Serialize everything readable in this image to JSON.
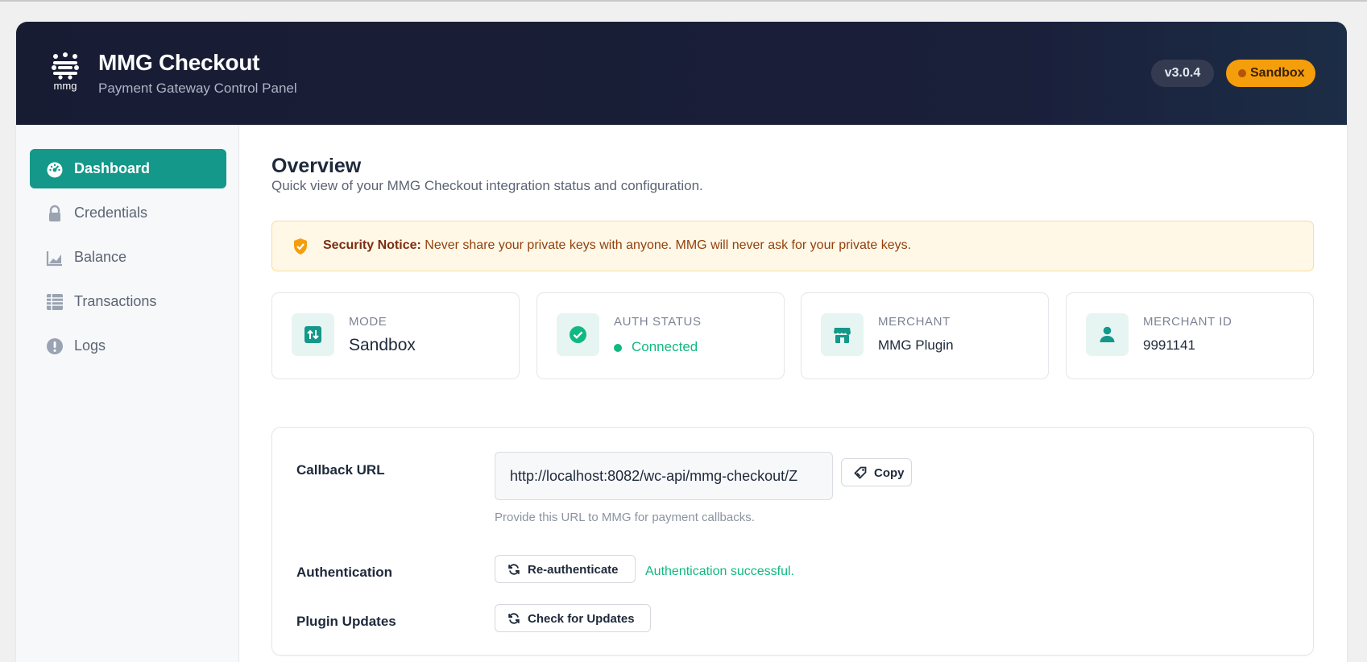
{
  "app": {
    "title": "MMG Checkout",
    "subtitle": "Payment Gateway Control Panel",
    "logo_text": "mmg",
    "version": "v3.0.4",
    "environment": "Sandbox"
  },
  "colors": {
    "header_bg": "#1a1f3a",
    "accent": "#14988a",
    "sandbox_badge": "#f59e0b",
    "success": "#10b981",
    "notice_bg": "#fff8e6"
  },
  "sidebar": {
    "items": [
      {
        "label": "Dashboard",
        "icon": "gauge-icon",
        "active": true
      },
      {
        "label": "Credentials",
        "icon": "lock-icon",
        "active": false
      },
      {
        "label": "Balance",
        "icon": "chart-icon",
        "active": false
      },
      {
        "label": "Transactions",
        "icon": "table-icon",
        "active": false
      },
      {
        "label": "Logs",
        "icon": "exclamation-icon",
        "active": false
      }
    ]
  },
  "main": {
    "title": "Overview",
    "description": "Quick view of your MMG Checkout integration status and configuration.",
    "notice": {
      "heading": "Security Notice:",
      "text": "Never share your private keys with anyone. MMG will never ask for your private keys."
    },
    "cards": [
      {
        "label": "Mode",
        "value": "Sandbox",
        "icon": "switch-icon"
      },
      {
        "label": "Auth Status",
        "value": "Connected",
        "icon": "check-circle-icon"
      },
      {
        "label": "Merchant",
        "value": "MMG Plugin",
        "icon": "store-icon"
      },
      {
        "label": "Merchant ID",
        "value": "9991141",
        "icon": "user-icon"
      }
    ],
    "settings": {
      "callback_label": "Callback URL",
      "callback_url": "http://localhost:8082/wc-api/mmg-checkout/Z",
      "copy_label": "Copy",
      "callback_help": "Provide this URL to MMG for payment callbacks.",
      "auth_label": "Authentication",
      "reauth_label": "Re-authenticate",
      "auth_result": "Authentication successful.",
      "updates_label": "Plugin Updates",
      "check_updates_label": "Check for Updates"
    }
  }
}
